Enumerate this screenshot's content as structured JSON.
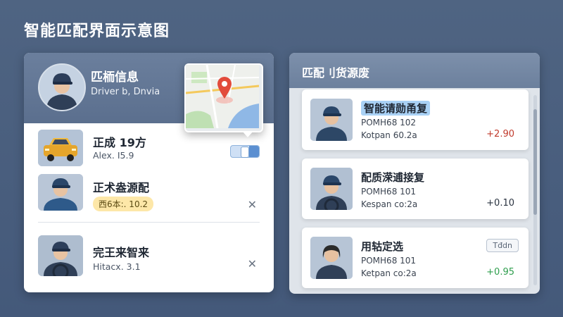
{
  "page": {
    "title": "智能匹配界面示意图"
  },
  "driver_card": {
    "header_name": "匹栭信息",
    "header_sub": "Driver b, Dnvia",
    "rows": [
      {
        "title": "正成 19方",
        "sub": "Alex. I5.9",
        "icon": "car-thumb"
      },
      {
        "title": "正术盎源配",
        "tag": "西6本:. 10.2",
        "icon": "driver-thumb"
      },
      {
        "title": "完王来智来",
        "sub": "Hitacx. 3.1",
        "icon": "driver-thumb"
      }
    ]
  },
  "cargo_panel": {
    "title": "匹配刂货源废",
    "items": [
      {
        "title": "智能请勋甬复",
        "line2": "POMH68 102",
        "line3": "Kotpan 60.2a",
        "value": "+2.90",
        "value_color": "#c0392b",
        "highlight": true
      },
      {
        "title": "配质溁逋接复",
        "line2": "POMH68 101",
        "line3": "Kespan co:2a",
        "value": "+0.10",
        "value_color": "#2a3340",
        "highlight": false
      },
      {
        "title": "用轱定选",
        "line2": "POMH68 101",
        "line3": "Ketpan co:2a",
        "value": "+0.95",
        "value_color": "#2e9e4d",
        "highlight": false,
        "badge": "Tđdn"
      }
    ]
  },
  "colors": {
    "accent": "#5b8fd1",
    "positive": "#2e9e4d",
    "negative": "#c0392b"
  },
  "icons": {
    "close": "close-icon",
    "map": "map-pin-icon"
  }
}
